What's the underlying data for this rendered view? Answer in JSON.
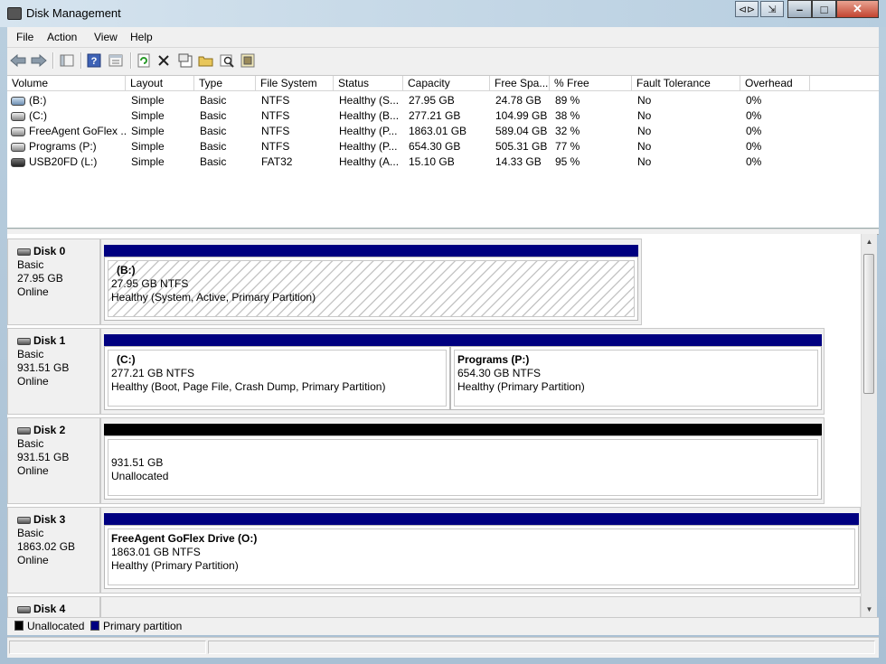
{
  "window": {
    "title": "Disk Management"
  },
  "menu": [
    "File",
    "Action",
    "View",
    "Help"
  ],
  "toolbar": {
    "buttons": [
      "back-arrow-icon",
      "forward-arrow-icon",
      "console-tree-icon",
      "help-icon",
      "properties-pane-icon",
      "refresh-icon",
      "delete-icon",
      "properties-icon",
      "open-folder-icon",
      "search-icon",
      "check-disk-icon"
    ]
  },
  "volumes": {
    "columns": [
      "Volume",
      "Layout",
      "Type",
      "File System",
      "Status",
      "Capacity",
      "Free Spa...",
      "% Free",
      "Fault Tolerance",
      "Overhead"
    ],
    "rows": [
      {
        "volume": "(B:)",
        "layout": "Simple",
        "type": "Basic",
        "fs": "NTFS",
        "status": "Healthy (S...",
        "capacity": "27.95 GB",
        "free": "24.78 GB",
        "pct": "89 %",
        "fault": "No",
        "overhead": "0%"
      },
      {
        "volume": "(C:)",
        "layout": "Simple",
        "type": "Basic",
        "fs": "NTFS",
        "status": "Healthy (B...",
        "capacity": "277.21 GB",
        "free": "104.99 GB",
        "pct": "38 %",
        "fault": "No",
        "overhead": "0%"
      },
      {
        "volume": "FreeAgent GoFlex ...",
        "layout": "Simple",
        "type": "Basic",
        "fs": "NTFS",
        "status": "Healthy (P...",
        "capacity": "1863.01 GB",
        "free": "589.04 GB",
        "pct": "32 %",
        "fault": "No",
        "overhead": "0%"
      },
      {
        "volume": "Programs (P:)",
        "layout": "Simple",
        "type": "Basic",
        "fs": "NTFS",
        "status": "Healthy (P...",
        "capacity": "654.30 GB",
        "free": "505.31 GB",
        "pct": "77 %",
        "fault": "No",
        "overhead": "0%"
      },
      {
        "volume": "USB20FD (L:)",
        "layout": "Simple",
        "type": "Basic",
        "fs": "FAT32",
        "status": "Healthy (A...",
        "capacity": "15.10 GB",
        "free": "14.33 GB",
        "pct": "95 %",
        "fault": "No",
        "overhead": "0%"
      }
    ]
  },
  "disks": [
    {
      "name": "Disk 0",
      "type": "Basic",
      "size": "27.95 GB",
      "state": "Online",
      "partitions": [
        {
          "title": "(B:)",
          "size": "27.95 GB NTFS",
          "status": "Healthy (System, Active, Primary Partition)"
        }
      ]
    },
    {
      "name": "Disk 1",
      "type": "Basic",
      "size": "931.51 GB",
      "state": "Online",
      "partitions": [
        {
          "title": "(C:)",
          "size": "277.21 GB NTFS",
          "status": "Healthy (Boot, Page File, Crash Dump, Primary Partition)"
        },
        {
          "title": "Programs  (P:)",
          "size": "654.30 GB NTFS",
          "status": "Healthy (Primary Partition)"
        }
      ]
    },
    {
      "name": "Disk 2",
      "type": "Basic",
      "size": "931.51 GB",
      "state": "Online",
      "partitions": [
        {
          "title": "",
          "size": "931.51 GB",
          "status": "Unallocated"
        }
      ]
    },
    {
      "name": "Disk 3",
      "type": "Basic",
      "size": "1863.02 GB",
      "state": "Online",
      "partitions": [
        {
          "title": "FreeAgent GoFlex Drive  (O:)",
          "size": "1863.01 GB NTFS",
          "status": "Healthy (Primary Partition)"
        }
      ]
    },
    {
      "name": "Disk 4"
    }
  ],
  "legend": {
    "unallocated": "Unallocated",
    "primary": "Primary partition"
  },
  "colors": {
    "primary": "#000080",
    "unallocated": "#000000"
  }
}
